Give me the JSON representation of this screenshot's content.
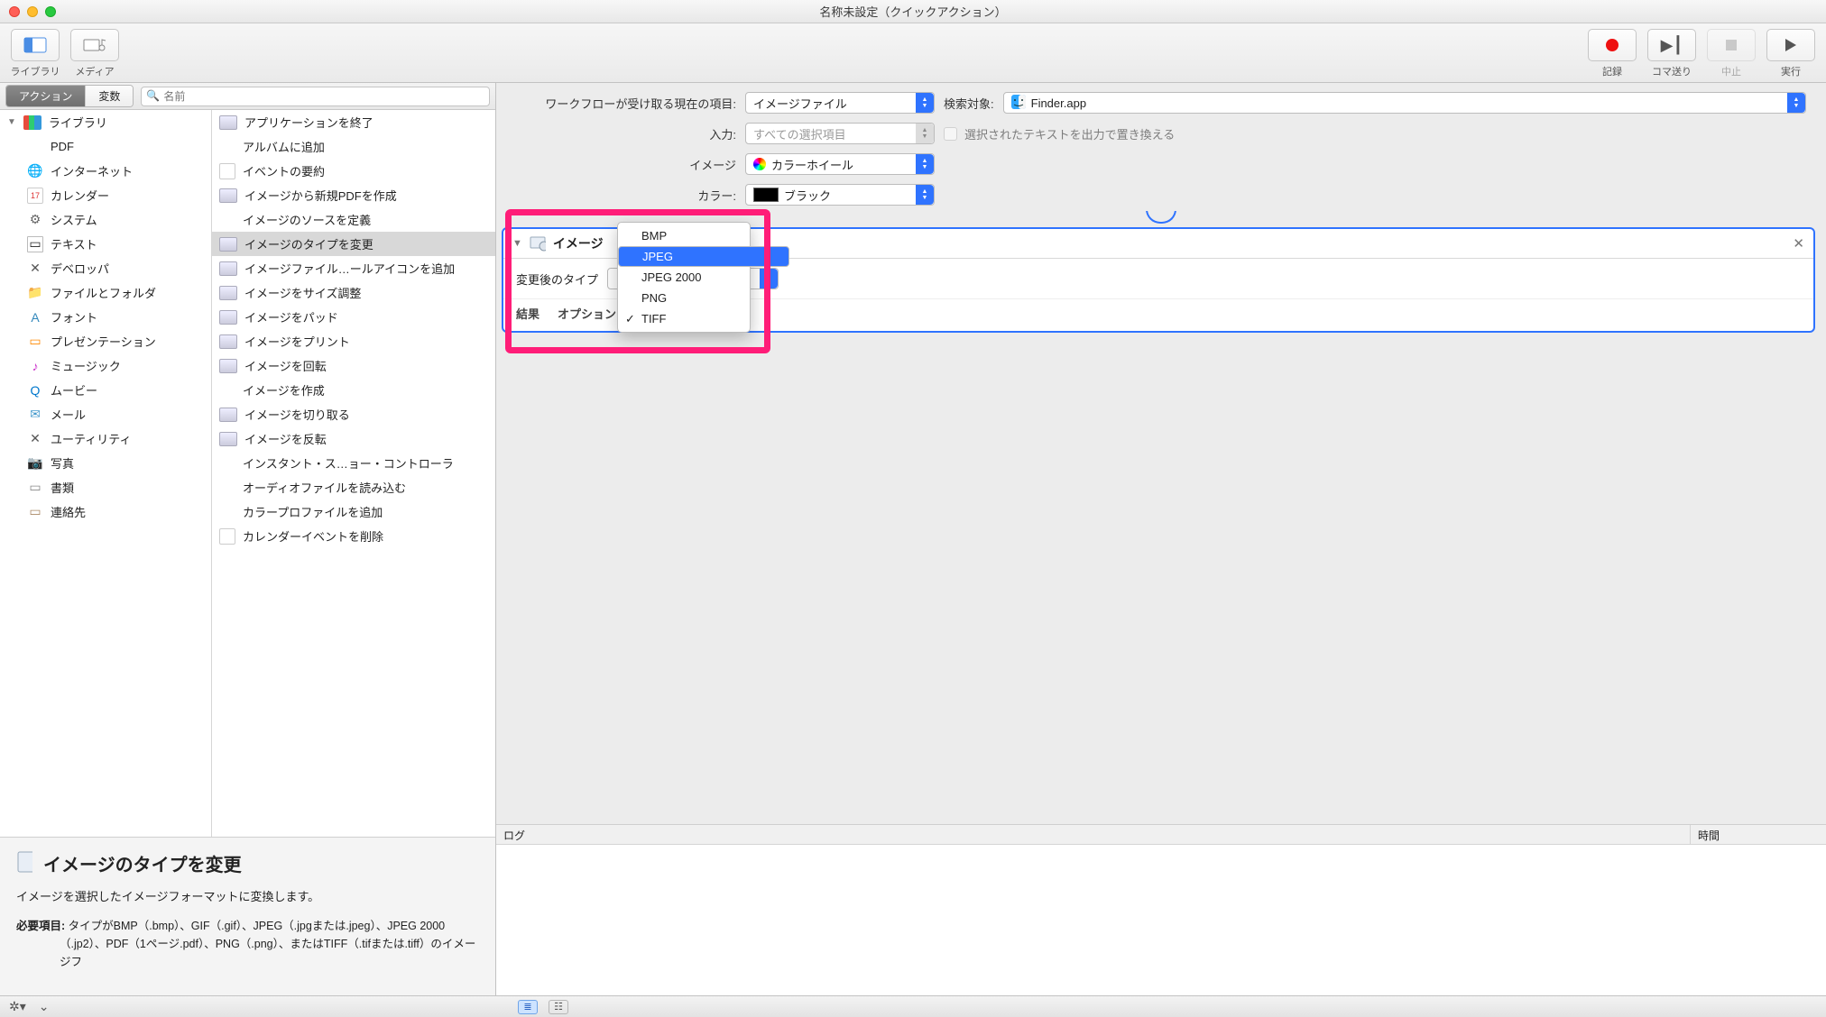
{
  "window": {
    "title": "名称未設定（クイックアクション）"
  },
  "toolbar": {
    "library": "ライブラリ",
    "media": "メディア",
    "record": "記録",
    "step": "コマ送り",
    "stop": "中止",
    "run": "実行"
  },
  "tabs": {
    "actions": "アクション",
    "variables": "変数"
  },
  "search": {
    "placeholder": "名前"
  },
  "categories": {
    "library": "ライブラリ",
    "items": [
      "PDF",
      "インターネット",
      "カレンダー",
      "システム",
      "テキスト",
      "デベロッパ",
      "ファイルとフォルダ",
      "フォント",
      "プレゼンテーション",
      "ミュージック",
      "ムービー",
      "メール",
      "ユーティリティ",
      "写真",
      "書類",
      "連絡先"
    ]
  },
  "actions": {
    "items": [
      "アプリケーションを終了",
      "アルバムに追加",
      "イベントの要約",
      "イメージから新規PDFを作成",
      "イメージのソースを定義",
      "イメージのタイプを変更",
      "イメージファイル…ールアイコンを追加",
      "イメージをサイズ調整",
      "イメージをパッド",
      "イメージをプリント",
      "イメージを回転",
      "イメージを作成",
      "イメージを切り取る",
      "イメージを反転",
      "インスタント・ス…ョー・コントローラ",
      "オーディオファイルを読み込む",
      "カラープロファイルを追加",
      "カレンダーイベントを削除"
    ],
    "selected_index": 5
  },
  "description": {
    "title": "イメージのタイプを変更",
    "blurb": "イメージを選択したイメージフォーマットに変換します。",
    "req_label": "必要項目:",
    "req_text": "タイプがBMP（.bmp）、GIF（.gif）、JPEG（.jpgまたは.jpeg）、JPEG 2000（.jp2）、PDF（1ページ.pdf）、PNG（.png）、またはTIFF（.tifまたは.tiff）のイメージフ"
  },
  "workflow": {
    "receives_label": "ワークフローが受け取る現在の項目:",
    "receives_value": "イメージファイル",
    "search_in_label": "検索対象:",
    "search_in_value": "Finder.app",
    "input_label": "入力:",
    "input_value": "すべての選択項目",
    "replace_checkbox": "選択されたテキストを出力で置き換える",
    "image_label": "イメージ",
    "image_value": "カラーホイール",
    "color_label": "カラー:",
    "color_value": "ブラック"
  },
  "card": {
    "title": "イメージ",
    "type_label": "変更後のタイプ",
    "results": "結果",
    "options": "オプション"
  },
  "popup": {
    "options": [
      "BMP",
      "JPEG",
      "JPEG 2000",
      "PNG",
      "TIFF"
    ],
    "highlighted_index": 1,
    "checked_index": 4
  },
  "log": {
    "col_log": "ログ",
    "col_time": "時間"
  },
  "footer": {
    "gear": "✻"
  }
}
